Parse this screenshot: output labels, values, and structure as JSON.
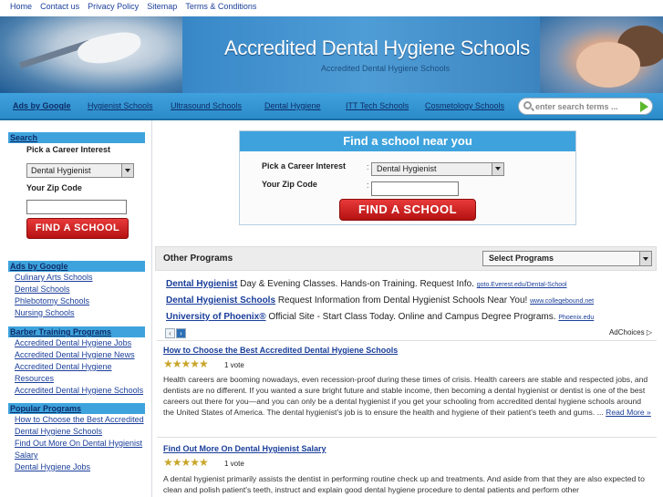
{
  "topnav": [
    "Home",
    "Contact us",
    "Privacy Policy",
    "Sitemap",
    "Terms & Conditions"
  ],
  "banner": {
    "title": "Accredited Dental Hygiene Schools",
    "subtitle": "Accredited Dental Hygiene Schools"
  },
  "menubar": {
    "ads_label": "Ads by Google",
    "links": [
      "Hygienist Schools",
      "Ultrasound Schools",
      "Dental Hygiene",
      "ITT Tech Schools",
      "Cosmetology Schools"
    ]
  },
  "search": {
    "placeholder": "enter search terms ..."
  },
  "sidebar": {
    "search_head": "Search",
    "career_label": "Pick a Career Interest",
    "career_value": "Dental Hygienist",
    "zip_label": "Your Zip Code",
    "button": "FIND A SCHOOL",
    "ads_head": "Ads by Google",
    "ads_links": [
      "Culinary Arts Schools",
      "Dental Schools",
      "Phlebotomy Schools",
      "Nursing Schools"
    ],
    "barber_head": "Barber Training Programs",
    "barber_links": [
      "Accredited Dental Hygiene Jobs",
      "Accredited Dental Hygiene News",
      "Accredited Dental Hygiene Resources",
      "Accredited Dental Hygiene Schools"
    ],
    "popular_head": "Popular Programs",
    "popular_links": [
      "How to Choose the Best Accredited Dental Hygiene Schools",
      "Find Out More On Dental Hygienist Salary",
      "Dental Hygiene Jobs"
    ]
  },
  "panel": {
    "title": "Find a school near you",
    "career_label": "Pick a Career Interest",
    "career_value": "Dental Hygienist",
    "zip_label": "Your Zip Code",
    "colon": ":",
    "button": "FIND A SCHOOL"
  },
  "other": {
    "label": "Other Programs",
    "select": "Select Programs"
  },
  "ads": [
    {
      "title": "Dental Hygienist",
      "text": "Day & Evening Classes. Hands-on Training. Request Info.",
      "url": "goto.Everest.edu/Dental-School"
    },
    {
      "title": "Dental Hygienist Schools",
      "text": "Request Information from Dental Hygienist Schools Near You!",
      "url": "www.collegebound.net"
    },
    {
      "title": "University of Phoenix®",
      "text": "Official Site - Start Class Today. Online and Campus Degree Programs.",
      "url": "Phoenix.edu"
    }
  ],
  "ad_nav": {
    "prev": "‹",
    "next": "›"
  },
  "adchoices": "AdChoices ▷",
  "articles": [
    {
      "title": "How to Choose the Best Accredited Dental Hygiene Schools",
      "stars": "★★★★★",
      "votes": "1 vote",
      "body": "Health careers are booming nowadays, even recession-proof during these times of crisis. Health careers are stable and respected jobs, and dentists are no different. If you wanted a sure bright future and stable income, then becoming a dental hygienist or dentist is one of the best careers out there for you—and you can only be a dental hygienist if you get your schooling from accredited dental hygiene schools around the United States of America. The dental hygienist's job is to ensure the health and hygiene of their patient's teeth and gums. ...",
      "more": "Read More »"
    },
    {
      "title": "Find Out More On Dental Hygienist Salary",
      "stars": "★★★★★",
      "votes": "1 vote",
      "body": "A dental hygienist primarily assists the dentist in performing routine check up and treatments. And aside from that they are also expected to clean and polish patient's teeth, instruct and explain good dental hygiene procedure to dental patients and perform other"
    }
  ]
}
